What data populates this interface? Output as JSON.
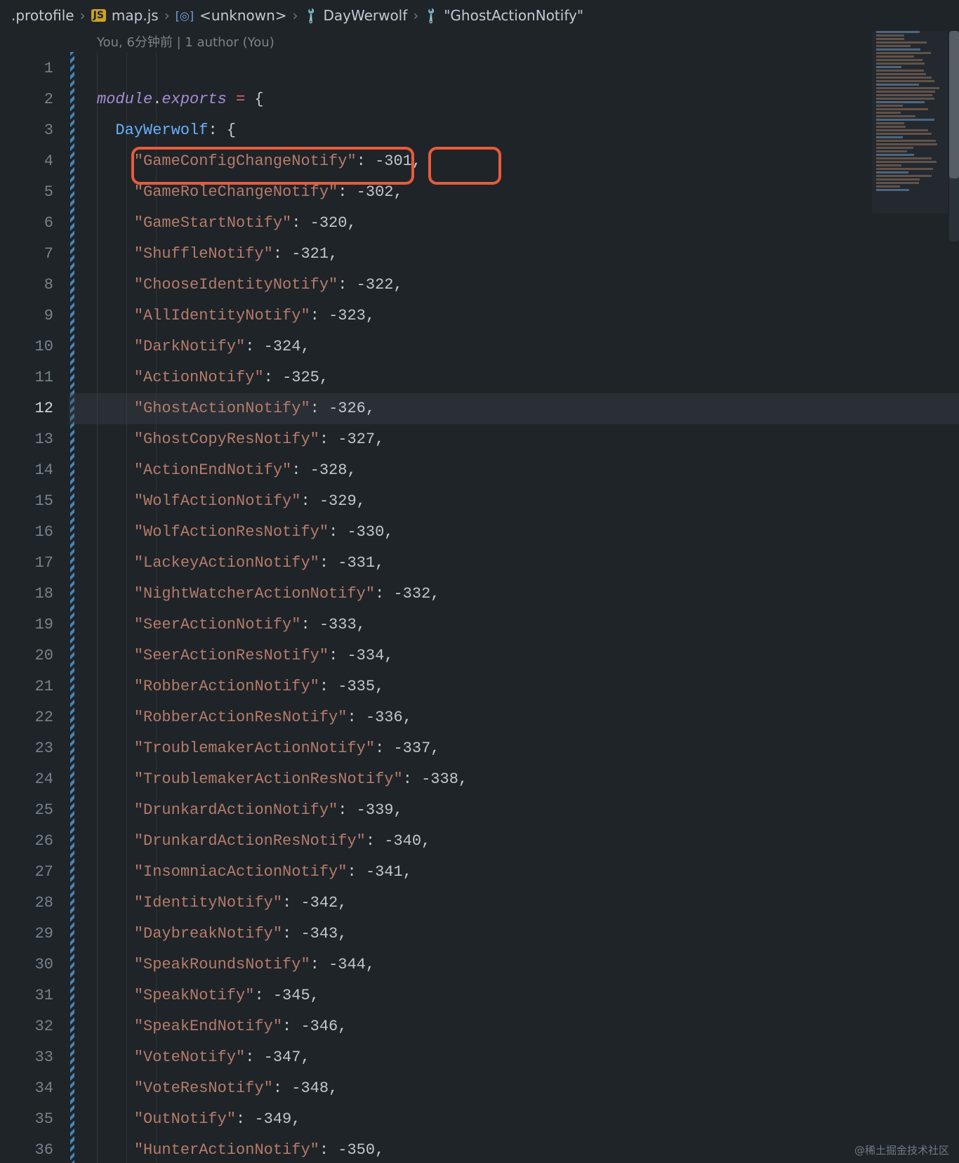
{
  "breadcrumbs": {
    "protofile": ".protofile",
    "file": "map.js",
    "ns": "<unknown>",
    "obj": "DayWerwolf",
    "leaf": "\"GhostActionNotify\""
  },
  "codelens": "You, 6分钟前 | 1 author (You)",
  "currentLine": 12,
  "line1": {
    "module": "module",
    "dot": ".",
    "exports": "exports",
    "eq": " = ",
    "brace": "{"
  },
  "line2": {
    "key": "DayWerwolf",
    "colon": ": ",
    "brace": "{"
  },
  "entries": [
    {
      "key": "GameConfigChangeNotify",
      "val": "-301"
    },
    {
      "key": "GameRoleChangeNotify",
      "val": "-302"
    },
    {
      "key": "GameStartNotify",
      "val": "-320"
    },
    {
      "key": "ShuffleNotify",
      "val": "-321"
    },
    {
      "key": "ChooseIdentityNotify",
      "val": "-322"
    },
    {
      "key": "AllIdentityNotify",
      "val": "-323"
    },
    {
      "key": "DarkNotify",
      "val": "-324"
    },
    {
      "key": "ActionNotify",
      "val": "-325"
    },
    {
      "key": "GhostActionNotify",
      "val": "-326"
    },
    {
      "key": "GhostCopyResNotify",
      "val": "-327"
    },
    {
      "key": "ActionEndNotify",
      "val": "-328"
    },
    {
      "key": "WolfActionNotify",
      "val": "-329"
    },
    {
      "key": "WolfActionResNotify",
      "val": "-330"
    },
    {
      "key": "LackeyActionNotify",
      "val": "-331"
    },
    {
      "key": "NightWatcherActionNotify",
      "val": "-332"
    },
    {
      "key": "SeerActionNotify",
      "val": "-333"
    },
    {
      "key": "SeerActionResNotify",
      "val": "-334"
    },
    {
      "key": "RobberActionNotify",
      "val": "-335"
    },
    {
      "key": "RobberActionResNotify",
      "val": "-336"
    },
    {
      "key": "TroublemakerActionNotify",
      "val": "-337"
    },
    {
      "key": "TroublemakerActionResNotify",
      "val": "-338"
    },
    {
      "key": "DrunkardActionNotify",
      "val": "-339"
    },
    {
      "key": "DrunkardActionResNotify",
      "val": "-340"
    },
    {
      "key": "InsomniacActionNotify",
      "val": "-341"
    },
    {
      "key": "IdentityNotify",
      "val": "-342"
    },
    {
      "key": "DaybreakNotify",
      "val": "-343"
    },
    {
      "key": "SpeakRoundsNotify",
      "val": "-344"
    },
    {
      "key": "SpeakNotify",
      "val": "-345"
    },
    {
      "key": "SpeakEndNotify",
      "val": "-346"
    },
    {
      "key": "VoteNotify",
      "val": "-347"
    },
    {
      "key": "VoteResNotify",
      "val": "-348"
    },
    {
      "key": "OutNotify",
      "val": "-349"
    },
    {
      "key": "HunterActionNotify",
      "val": "-350"
    }
  ],
  "watermark": "@稀土掘金技术社区"
}
